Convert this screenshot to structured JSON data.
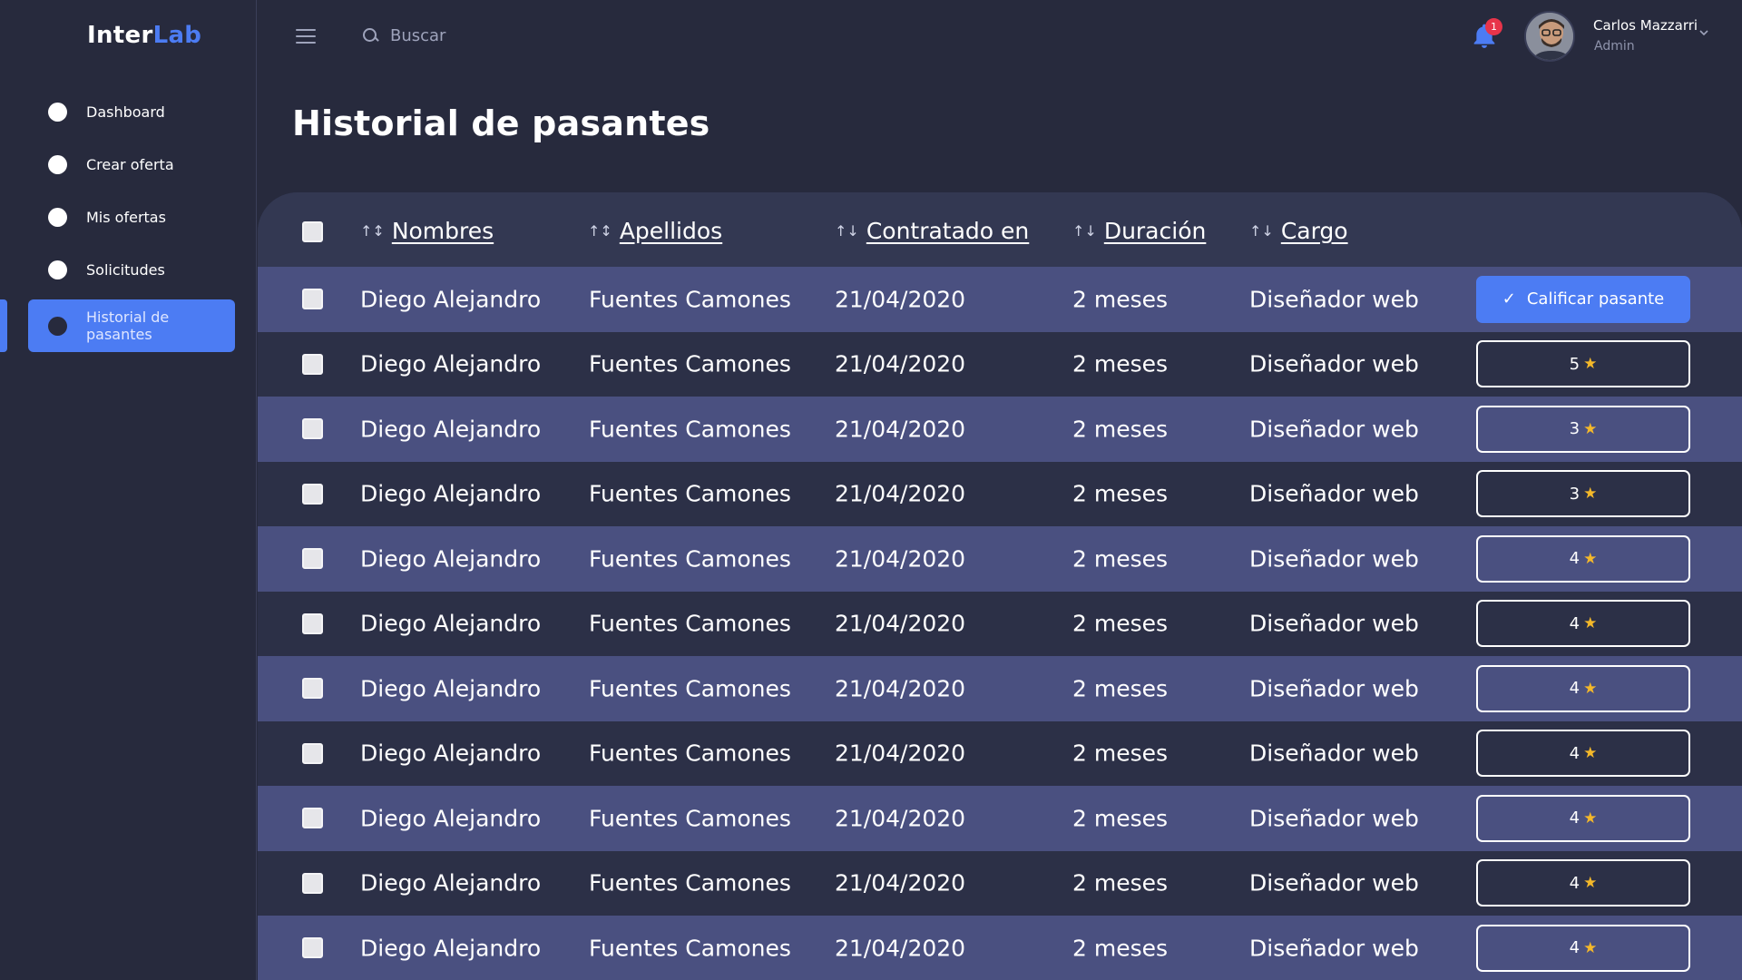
{
  "app": {
    "logo_part1": "Inter",
    "logo_part2": "Lab"
  },
  "sidebar": {
    "items": [
      {
        "label": "Dashboard"
      },
      {
        "label": "Crear oferta"
      },
      {
        "label": "Mis ofertas"
      },
      {
        "label": "Solicitudes"
      },
      {
        "label": "Historial de pasantes",
        "active": true
      }
    ]
  },
  "header": {
    "search_placeholder": "Buscar",
    "notification_count": "1",
    "user_name": "Carlos Mazzarri",
    "user_role": "Admin"
  },
  "page": {
    "title": "Historial de pasantes"
  },
  "table": {
    "columns": [
      {
        "label": "Nombres",
        "sort_icon": "↑↕"
      },
      {
        "label": "Apellidos",
        "sort_icon": "↑↕"
      },
      {
        "label": "Contratado en",
        "sort_icon": "↑↓"
      },
      {
        "label": "Duración",
        "sort_icon": "↑↓"
      },
      {
        "label": "Cargo",
        "sort_icon": "↑↓"
      }
    ],
    "rate_button_label": "Calificar pasante",
    "rows": [
      {
        "nombres": "Diego Alejandro",
        "apellidos": "Fuentes Camones",
        "contratado": "21/04/2020",
        "duracion": "2 meses",
        "cargo": "Diseñador web",
        "rating": null
      },
      {
        "nombres": "Diego Alejandro",
        "apellidos": "Fuentes Camones",
        "contratado": "21/04/2020",
        "duracion": "2 meses",
        "cargo": "Diseñador web",
        "rating": "5"
      },
      {
        "nombres": "Diego Alejandro",
        "apellidos": "Fuentes Camones",
        "contratado": "21/04/2020",
        "duracion": "2 meses",
        "cargo": "Diseñador web",
        "rating": "3"
      },
      {
        "nombres": "Diego Alejandro",
        "apellidos": "Fuentes Camones",
        "contratado": "21/04/2020",
        "duracion": "2 meses",
        "cargo": "Diseñador web",
        "rating": "3"
      },
      {
        "nombres": "Diego Alejandro",
        "apellidos": "Fuentes Camones",
        "contratado": "21/04/2020",
        "duracion": "2 meses",
        "cargo": "Diseñador web",
        "rating": "4"
      },
      {
        "nombres": "Diego Alejandro",
        "apellidos": "Fuentes Camones",
        "contratado": "21/04/2020",
        "duracion": "2 meses",
        "cargo": "Diseñador web",
        "rating": "4"
      },
      {
        "nombres": "Diego Alejandro",
        "apellidos": "Fuentes Camones",
        "contratado": "21/04/2020",
        "duracion": "2 meses",
        "cargo": "Diseñador web",
        "rating": "4"
      },
      {
        "nombres": "Diego Alejandro",
        "apellidos": "Fuentes Camones",
        "contratado": "21/04/2020",
        "duracion": "2 meses",
        "cargo": "Diseñador web",
        "rating": "4"
      },
      {
        "nombres": "Diego Alejandro",
        "apellidos": "Fuentes Camones",
        "contratado": "21/04/2020",
        "duracion": "2 meses",
        "cargo": "Diseñador web",
        "rating": "4"
      },
      {
        "nombres": "Diego Alejandro",
        "apellidos": "Fuentes Camones",
        "contratado": "21/04/2020",
        "duracion": "2 meses",
        "cargo": "Diseñador web",
        "rating": "4"
      },
      {
        "nombres": "Diego Alejandro",
        "apellidos": "Fuentes Camones",
        "contratado": "21/04/2020",
        "duracion": "2 meses",
        "cargo": "Diseñador web",
        "rating": "4"
      }
    ]
  },
  "colors": {
    "accent": "#4c7cf3",
    "star": "#f4b82a",
    "badge": "#e8344a",
    "background": "#272a3d"
  },
  "icons": {
    "menu": "hamburger-icon",
    "search": "search-icon",
    "bell": "bell-icon",
    "chevron": "chevron-down-icon",
    "star": "star-icon",
    "check": "check-icon"
  }
}
